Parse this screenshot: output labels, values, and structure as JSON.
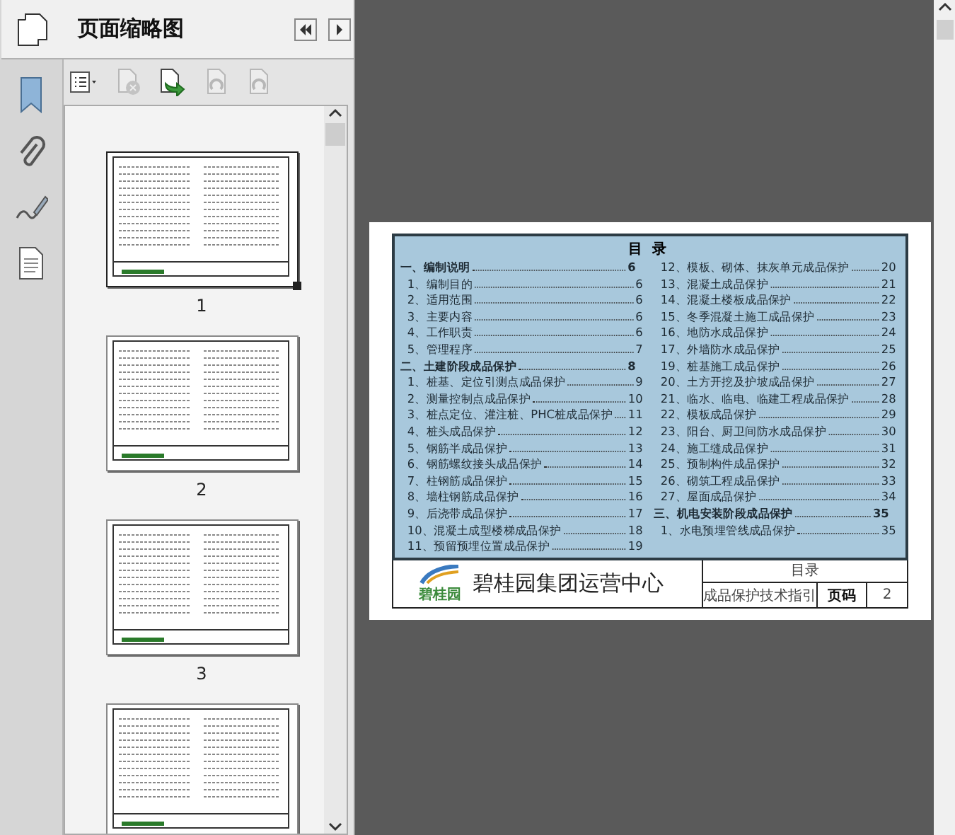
{
  "panel": {
    "title": "页面缩略图"
  },
  "toolbar": [
    {
      "kind": "options",
      "disabled": false
    },
    {
      "kind": "delete",
      "disabled": true
    },
    {
      "kind": "insert",
      "disabled": false
    },
    {
      "kind": "rotate-left",
      "disabled": true
    },
    {
      "kind": "rotate-right",
      "disabled": true
    }
  ],
  "thumbnails": [
    {
      "label": "1",
      "selected": true
    },
    {
      "label": "2",
      "selected": false
    },
    {
      "label": "3",
      "selected": false
    },
    {
      "selected": false
    }
  ],
  "document": {
    "heading": "目  录",
    "columns": [
      [
        {
          "kind": "section",
          "text": "一、编制说明",
          "page": "6"
        },
        {
          "kind": "item",
          "text": "1、编制目的",
          "page": "6"
        },
        {
          "kind": "item",
          "text": "2、适用范围",
          "page": "6"
        },
        {
          "kind": "item",
          "text": "3、主要内容",
          "page": "6"
        },
        {
          "kind": "item",
          "text": "4、工作职责",
          "page": "6"
        },
        {
          "kind": "item",
          "text": "5、管理程序",
          "page": "7"
        },
        {
          "kind": "section",
          "text": "二、土建阶段成品保护",
          "page": "8"
        },
        {
          "kind": "item",
          "text": "1、桩基、定位引测点成品保护",
          "page": "9"
        },
        {
          "kind": "item",
          "text": "2、测量控制点成品保护",
          "page": "10"
        },
        {
          "kind": "item",
          "text": "3、桩点定位、灌注桩、PHC桩成品保护",
          "page": "11"
        },
        {
          "kind": "item",
          "text": "4、桩头成品保护",
          "page": "12"
        },
        {
          "kind": "item",
          "text": "5、钢筋半成品保护",
          "page": "13"
        },
        {
          "kind": "item",
          "text": "6、钢筋螺纹接头成品保护",
          "page": "14"
        },
        {
          "kind": "item",
          "text": "7、柱钢筋成品保护",
          "page": "15"
        },
        {
          "kind": "item",
          "text": "8、墙柱钢筋成品保护",
          "page": "16"
        },
        {
          "kind": "item",
          "text": "9、后浇带成品保护",
          "page": "17"
        },
        {
          "kind": "item",
          "text": "10、混凝土成型楼梯成品保护",
          "page": "18"
        },
        {
          "kind": "item",
          "text": "11、预留预埋位置成品保护",
          "page": "19"
        }
      ],
      [
        {
          "kind": "item",
          "text": "12、模板、砌体、抹灰单元成品保护",
          "page": "20"
        },
        {
          "kind": "item",
          "text": "13、混凝土成品保护",
          "page": "21"
        },
        {
          "kind": "item",
          "text": "14、混凝土楼板成品保护",
          "page": "22"
        },
        {
          "kind": "item",
          "text": "15、冬季混凝土施工成品保护",
          "page": "23"
        },
        {
          "kind": "item",
          "text": "16、地防水成品保护",
          "page": "24"
        },
        {
          "kind": "item",
          "text": "17、外墙防水成品保护",
          "page": "25"
        },
        {
          "kind": "item",
          "text": "19、桩基施工成品保护",
          "page": "26"
        },
        {
          "kind": "item",
          "text": "20、土方开挖及护坡成品保护",
          "page": "27"
        },
        {
          "kind": "item",
          "text": "21、临水、临电、临建工程成品保护",
          "page": "28"
        },
        {
          "kind": "item",
          "text": "22、模板成品保护",
          "page": "29"
        },
        {
          "kind": "item",
          "text": "23、阳台、厨卫间防水成品保护",
          "page": "30"
        },
        {
          "kind": "item",
          "text": "24、施工缝成品保护",
          "page": "31"
        },
        {
          "kind": "item",
          "text": "25、预制构件成品保护",
          "page": "32"
        },
        {
          "kind": "item",
          "text": "26、砌筑工程成品保护",
          "page": "33"
        },
        {
          "kind": "item",
          "text": "27、屋面成品保护",
          "page": "34"
        },
        {
          "kind": "section",
          "text": "三、机电安装阶段成品保护",
          "page": "35"
        },
        {
          "kind": "item",
          "text": "1、水电预埋管线成品保护",
          "page": "35"
        }
      ]
    ],
    "footer": {
      "logo_text": "碧桂园",
      "company": "碧桂园集团运营中心",
      "section": "目录",
      "doc_title": "成品保护技术指引",
      "page_label": "页码",
      "page_number": "2"
    }
  }
}
